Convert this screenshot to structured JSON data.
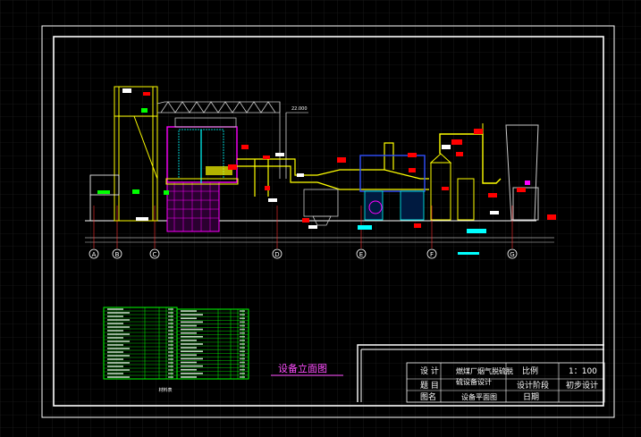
{
  "drawing": {
    "section_title": "设备立面图",
    "material_table_caption": "材料表",
    "level_mark": "22.000",
    "axis_labels": [
      "A",
      "B",
      "C",
      "D",
      "E",
      "F",
      "G"
    ]
  },
  "title_block": {
    "design_label": "设 计",
    "subject_label": "题 目",
    "subject_line1": "燃煤厂烟气脱硫脱",
    "subject_line2": "硫设备设计",
    "drawing_name_label": "图名",
    "drawing_name_value": "设备平面图",
    "scale_label": "比例",
    "scale_value": "1：100",
    "stage_label": "设计阶段",
    "stage_value": "初步设计",
    "date_label": "日期"
  },
  "colors": {
    "background": "#000000",
    "grid": "#2a2a2a",
    "frame": "#ffffff",
    "equipment_yellow": "#ffff00",
    "equipment_magenta": "#ff00ff",
    "equipment_cyan": "#00ffff",
    "equipment_red": "#ff0000",
    "equipment_green": "#00ff00",
    "equipment_blue": "#3050ff",
    "table_green": "#00ff00"
  }
}
